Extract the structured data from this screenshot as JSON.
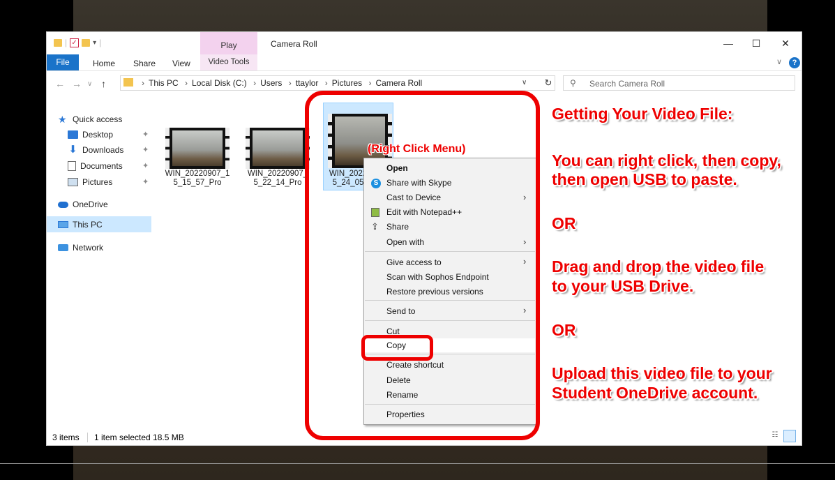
{
  "window": {
    "title": "Camera Roll",
    "contextual_tab": "Play",
    "contextual_group": "Video Tools",
    "controls": {
      "minimize": "—",
      "maximize": "☐",
      "close": "✕"
    }
  },
  "ribbon": {
    "tabs": [
      "File",
      "Home",
      "Share",
      "View"
    ]
  },
  "address": {
    "crumbs": [
      "This PC",
      "Local Disk (C:)",
      "Users",
      "ttaylor",
      "Pictures",
      "Camera Roll"
    ],
    "search_placeholder": "Search Camera Roll"
  },
  "nav": {
    "items": [
      {
        "label": "Quick access",
        "icon": "star-icon"
      },
      {
        "label": "Desktop",
        "icon": "desktop-icon",
        "pinned": true
      },
      {
        "label": "Downloads",
        "icon": "download-icon",
        "pinned": true
      },
      {
        "label": "Documents",
        "icon": "documents-icon",
        "pinned": true
      },
      {
        "label": "Pictures",
        "icon": "pictures-icon",
        "pinned": true
      },
      {
        "label": "OneDrive",
        "icon": "onedrive-icon"
      },
      {
        "label": "This PC",
        "icon": "this-pc-icon",
        "selected": true
      },
      {
        "label": "Network",
        "icon": "network-icon"
      }
    ]
  },
  "files": [
    {
      "name_line1": "WIN_20220907_1",
      "name_line2": "5_15_57_Pro"
    },
    {
      "name_line1": "WIN_20220907_",
      "name_line2": "5_22_14_Pro"
    },
    {
      "name_line1": "WIN_2022",
      "name_line2": "5_24_05",
      "selected": true
    }
  ],
  "status": {
    "count": "3 items",
    "selection": "1 item selected  18.5 MB"
  },
  "context_menu": {
    "items": [
      {
        "label": "Open",
        "bold": true
      },
      {
        "label": "Share with Skype",
        "icon": "skype-icon"
      },
      {
        "label": "Cast to Device",
        "submenu": true
      },
      {
        "label": "Edit with Notepad++",
        "icon": "notepad-icon"
      },
      {
        "label": "Share",
        "icon": "share-icon"
      },
      {
        "label": "Open with",
        "submenu": true
      },
      {
        "label": "Give access to",
        "submenu": true
      },
      {
        "label": "Scan with Sophos Endpoint"
      },
      {
        "label": "Restore previous versions"
      },
      {
        "label": "Send to",
        "submenu": true
      },
      {
        "label": "Cut"
      },
      {
        "label": "Copy",
        "highlighted": true
      },
      {
        "label": "Create shortcut"
      },
      {
        "label": "Delete"
      },
      {
        "label": "Rename"
      },
      {
        "label": "Properties"
      }
    ]
  },
  "annotations": {
    "right_click_label": "(Right Click Menu)",
    "heading": "Getting Your Video File:",
    "step1_line1": "You can right click, then copy,",
    "step1_line2": "then open USB to paste.",
    "or1": "OR",
    "step2_line1": "Drag and drop the video file",
    "step2_line2": "to your USB Drive.",
    "or2": "OR",
    "step3_line1": "Upload this video file to your",
    "step3_line2": "Student OneDrive account.",
    "color": "#e00000"
  }
}
